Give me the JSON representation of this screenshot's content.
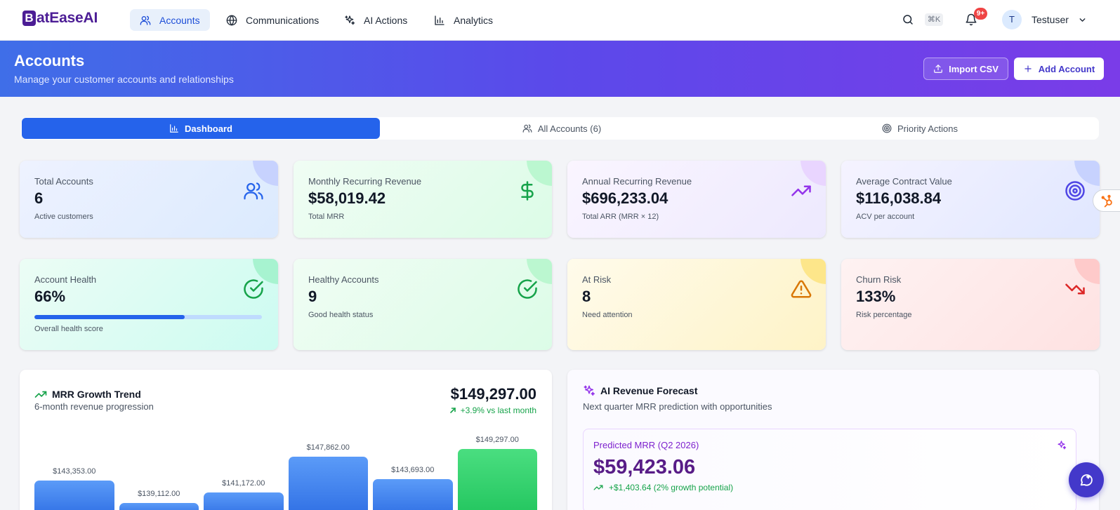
{
  "app": {
    "logo_letter": "B",
    "logo_text": "atEaseAI"
  },
  "nav": {
    "items": [
      {
        "label": "Accounts",
        "icon": "users-icon",
        "active": true
      },
      {
        "label": "Communications",
        "icon": "globe-icon",
        "active": false
      },
      {
        "label": "AI Actions",
        "icon": "sparkles-icon",
        "active": false
      },
      {
        "label": "Analytics",
        "icon": "bar-chart-icon",
        "active": false
      }
    ],
    "shortcut": "⌘K",
    "notifications_badge": "9+",
    "user_initial": "T",
    "user_name": "Testuser"
  },
  "header": {
    "title": "Accounts",
    "subtitle": "Manage your customer accounts and relationships",
    "import_label": "Import CSV",
    "add_label": "Add Account"
  },
  "tabs": [
    {
      "label": "Dashboard",
      "icon": "bar-chart-icon",
      "active": true
    },
    {
      "label": "All Accounts (6)",
      "icon": "users-icon",
      "active": false
    },
    {
      "label": "Priority Actions",
      "icon": "target-icon",
      "active": false
    }
  ],
  "stats": [
    {
      "label": "Total Accounts",
      "value": "6",
      "sub": "Active customers",
      "icon": "users-icon",
      "theme": "blue"
    },
    {
      "label": "Monthly Recurring Revenue",
      "value": "$58,019.42",
      "sub": "Total MRR",
      "icon": "dollar-icon",
      "theme": "green"
    },
    {
      "label": "Annual Recurring Revenue",
      "value": "$696,233.04",
      "sub": "Total ARR (MRR × 12)",
      "icon": "trending-up-icon",
      "theme": "purple"
    },
    {
      "label": "Average Contract Value",
      "value": "$116,038.84",
      "sub": "ACV per account",
      "icon": "target-icon",
      "theme": "indigo"
    },
    {
      "label": "Account Health",
      "value": "66%",
      "sub": "Overall health score",
      "icon": "check-circle-icon",
      "theme": "teal",
      "progress": 0.66
    },
    {
      "label": "Healthy Accounts",
      "value": "9",
      "sub": "Good health status",
      "icon": "check-circle-icon",
      "theme": "green"
    },
    {
      "label": "At Risk",
      "value": "8",
      "sub": "Need attention",
      "icon": "warning-icon",
      "theme": "yellow"
    },
    {
      "label": "Churn Risk",
      "value": "133%",
      "sub": "Risk percentage",
      "icon": "trending-down-icon",
      "theme": "red"
    }
  ],
  "mrr_trend": {
    "title": "MRR Growth Trend",
    "subtitle": "6-month revenue progression",
    "current": "$149,297.00",
    "change": "+3.9% vs last month"
  },
  "chart_data": {
    "type": "bar",
    "title": "MRR Growth Trend",
    "values": [
      143353,
      139112,
      141172,
      147862,
      143693,
      149297
    ],
    "labels": [
      "$143,353.00",
      "$139,112.00",
      "$141,172.00",
      "$147,862.00",
      "$143,693.00",
      "$149,297.00"
    ],
    "highlight_last": true,
    "colors": {
      "bar": "#3b82f6",
      "current": "#22c55e"
    }
  },
  "forecast": {
    "title": "AI Revenue Forecast",
    "subtitle": "Next quarter MRR prediction with opportunities",
    "box_label": "Predicted MRR (Q2 2026)",
    "box_value": "$59,423.06",
    "box_change": "+$1,403.64 (2% growth potential)"
  },
  "colors": {
    "primary": "#2563eb",
    "brand": "#4c1d95",
    "banner_start": "#3f6ee8",
    "banner_end": "#7a3ce8"
  }
}
